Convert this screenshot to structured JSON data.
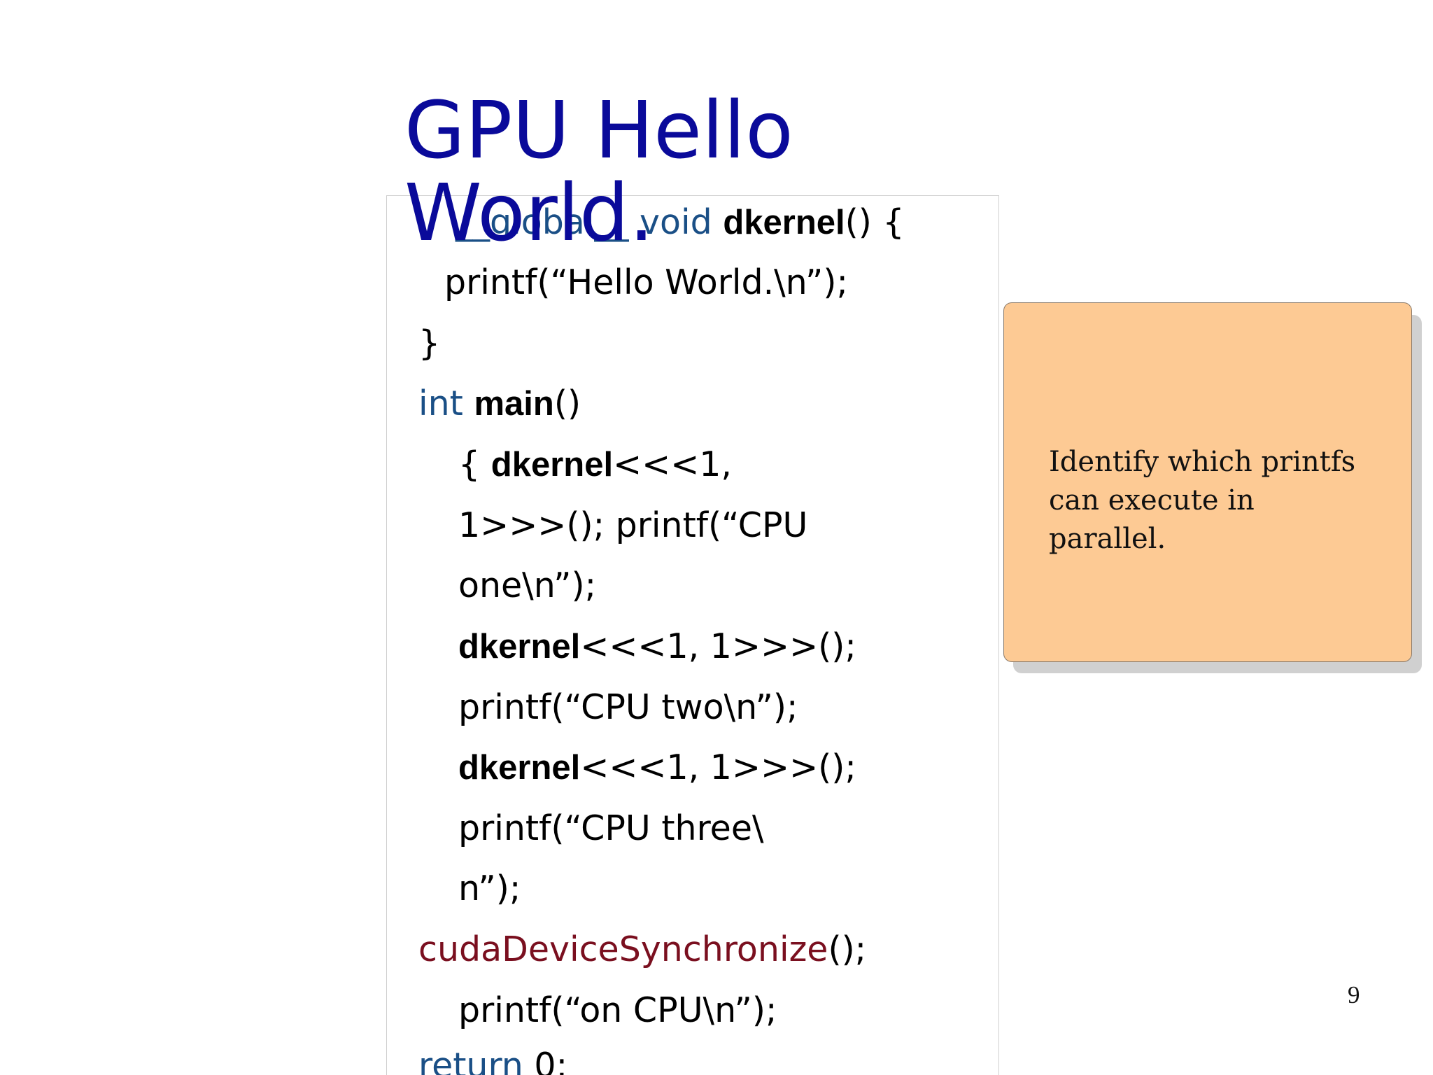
{
  "slide": {
    "title": "GPU Hello World.",
    "page_number": "9"
  },
  "code": {
    "line1": {
      "kw1": "__global__",
      "kw2": "void",
      "fn": "dkernel",
      "rest": "() {"
    },
    "line2": "printf(“Hello World.\\n”);",
    "line3": "}",
    "line4": {
      "kw": "int",
      "fn": "main",
      "rest": "()"
    },
    "line5": {
      "pre": "{ ",
      "fn": "dkernel",
      "rest": "<<<1,"
    },
    "line6": "1>>>(); printf(“CPU",
    "line7": "one\\n”);",
    "line8": {
      "fn": "dkernel",
      "rest": "<<<1, 1>>>();"
    },
    "line9": "printf(“CPU two\\n”);",
    "line10": {
      "fn": "dkernel",
      "rest": "<<<1, 1>>>();"
    },
    "line11": "printf(“CPU three\\",
    "line12": "n”);",
    "line13": {
      "cuda": "cudaDeviceSynchronize",
      "rest": "();"
    },
    "line14": "printf(“on CPU\\n”);",
    "line15": {
      "kw": "return",
      "rest": " 0;"
    }
  },
  "note": {
    "text": "Identify which printfs can execute in parallel."
  },
  "colors": {
    "title": "#0a0a9a",
    "keyword": "#1a4f86",
    "cuda_call": "#7a0f1f",
    "note_fill": "#fdca94"
  }
}
